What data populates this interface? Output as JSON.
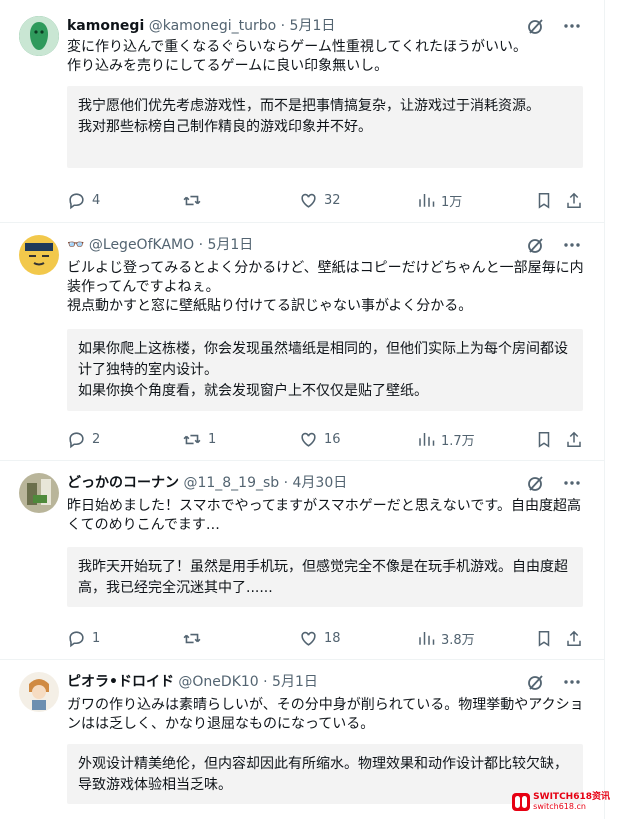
{
  "posts": [
    {
      "name": "kamonegi",
      "handle": "@kamonegi_turbo",
      "date": "· 5月1日",
      "text": "変に作り込んで重くなるぐらいならゲーム性重視してくれたほうがいい。\n作り込みを売りにしてるゲームに良い印象無いし。",
      "translation": "我宁愿他们优先考虑游戏性，而不是把事情搞复杂，让游戏过于消耗资源。\n我对那些标榜自己制作精良的游戏印象并不好。",
      "replies": "4",
      "reposts": "",
      "likes": "32",
      "views": "1万",
      "avatar_color": "#3fa36b"
    },
    {
      "name": "",
      "handle": "@LegeOfKAMO",
      "date": "· 5月1日",
      "text": "ビルよじ登ってみるとよく分かるけど、壁紙はコピーだけどちゃんと一部屋毎に内装作ってんですよねぇ。\n視点動かすと窓に壁紙貼り付けてる訳じゃない事がよく分かる。",
      "translation": "如果你爬上这栋楼，你会发现虽然墙纸是相同的，但他们实际上为每个房间都设计了独特的室内设计。\n如果你换个角度看，就会发现窗户上不仅仅是贴了壁纸。",
      "replies": "2",
      "reposts": "1",
      "likes": "16",
      "views": "1.7万",
      "avatar_color": "#f3c746"
    },
    {
      "name": "どっかのコーナン",
      "handle": "@11_8_19_sb",
      "date": "· 4月30日",
      "text": "昨日始めました！スマホでやってますがスマホゲーだと思えないです。自由度超高くてのめりこんでます…",
      "translation": "我昨天开始玩了！虽然是用手机玩，但感觉完全不像是在玩手机游戏。自由度超高，我已经完全沉迷其中了......",
      "replies": "1",
      "reposts": "",
      "likes": "18",
      "views": "3.8万",
      "avatar_color": "#8a8f6a"
    },
    {
      "name": "ピオラ•ドロイド",
      "handle": "@OneDK10",
      "date": "· 5月1日",
      "text": "ガワの作り込みは素晴らしいが、その分中身が削られている。物理挙動やアクションはは乏しく、かなり退屈なものになっている。",
      "translation": "外观设计精美绝伦，但内容却因此有所缩水。物理效果和动作设计都比较欠缺，导致游戏体验相当乏味。",
      "avatar_color": "#d9a56b"
    }
  ],
  "watermark": {
    "title": "SWITCH618资讯",
    "sub": "switch618.cn"
  },
  "icons": {
    "grok": "grok-icon",
    "more": "more-icon",
    "reply": "reply-icon",
    "repost": "repost-icon",
    "like": "like-icon",
    "views": "views-icon",
    "bookmark": "bookmark-icon",
    "share": "share-icon"
  }
}
